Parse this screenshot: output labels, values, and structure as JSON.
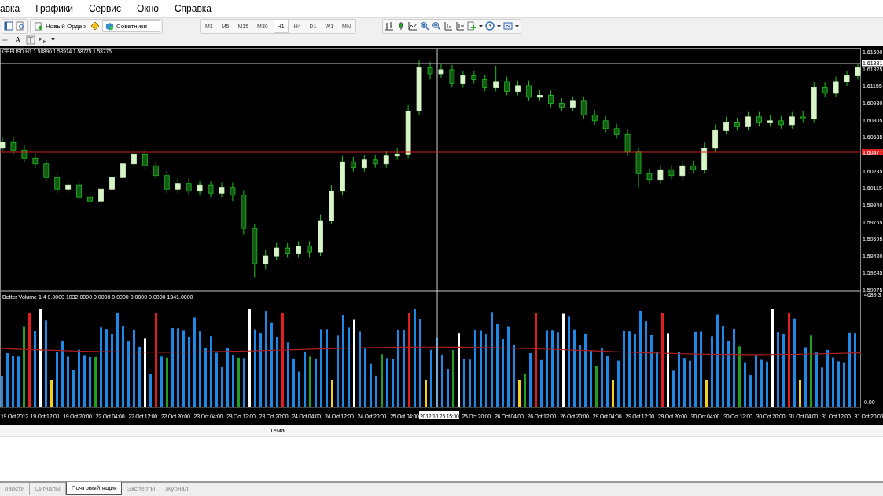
{
  "menu": [
    "авка",
    "Графики",
    "Сервис",
    "Окно",
    "Справка"
  ],
  "toolbar": {
    "new_order": "Новый Ордер",
    "experts": "Советники",
    "text_tool": "A",
    "timeframes": [
      {
        "label": "M1",
        "selected": false
      },
      {
        "label": "M5",
        "selected": false
      },
      {
        "label": "M15",
        "selected": false
      },
      {
        "label": "M30",
        "selected": false
      },
      {
        "label": "H1",
        "selected": true
      },
      {
        "label": "H4",
        "selected": false
      },
      {
        "label": "D1",
        "selected": false
      },
      {
        "label": "W1",
        "selected": false
      },
      {
        "label": "MN",
        "selected": false
      }
    ]
  },
  "chart": {
    "title": "GBPUSD.H1  1.58890 1.58914 1.58775 1.58775",
    "chart_data": {
      "type": "candlestick",
      "ylim": [
        1.5906,
        1.6154
      ],
      "yticks": [
        {
          "value": 1.615,
          "label": "1.61500"
        },
        {
          "value": 1.61325,
          "label": "1.61325"
        },
        {
          "value": 1.61155,
          "label": "1.61155"
        },
        {
          "value": 1.6098,
          "label": "1.60980"
        },
        {
          "value": 1.60805,
          "label": "1.60805"
        },
        {
          "value": 1.60635,
          "label": "1.60635"
        },
        {
          "value": 1.60285,
          "label": "1.60285"
        },
        {
          "value": 1.60115,
          "label": "1.60115"
        },
        {
          "value": 1.5994,
          "label": "1.59940"
        },
        {
          "value": 1.59765,
          "label": "1.59765"
        },
        {
          "value": 1.59595,
          "label": "1.59595"
        },
        {
          "value": 1.5942,
          "label": "1.59420"
        },
        {
          "value": 1.59245,
          "label": "1.59245"
        },
        {
          "value": 1.59075,
          "label": "1.59075"
        }
      ],
      "categories": [
        null,
        null,
        null,
        null,
        null,
        null,
        null,
        null,
        null,
        null,
        null,
        null,
        null,
        null,
        null,
        null,
        null,
        null,
        null,
        null,
        null,
        null,
        null,
        null,
        null,
        null,
        null,
        null,
        null,
        null,
        null,
        null,
        null,
        null,
        null,
        null,
        null,
        null,
        null,
        null,
        null,
        null,
        null,
        null,
        null,
        null,
        null,
        null,
        null,
        null,
        null,
        null,
        null,
        null,
        null,
        null,
        null,
        null,
        null,
        null,
        null,
        null,
        null,
        null,
        null,
        null,
        null,
        null,
        null,
        null,
        null,
        null,
        null,
        null,
        null,
        null,
        null,
        null,
        null
      ],
      "ohlc": [
        [
          1.6052,
          1.6063,
          1.6048,
          1.6058
        ],
        [
          1.6058,
          1.6063,
          1.6046,
          1.605
        ],
        [
          1.605,
          1.6055,
          1.6038,
          1.6042
        ],
        [
          1.6042,
          1.6047,
          1.6032,
          1.6036
        ],
        [
          1.6036,
          1.6041,
          1.6018,
          1.6022
        ],
        [
          1.6022,
          1.6027,
          1.6006,
          1.601
        ],
        [
          1.601,
          1.6019,
          1.6006,
          1.6014
        ],
        [
          1.6014,
          1.6019,
          1.5998,
          1.6002
        ],
        [
          1.6002,
          1.6007,
          1.599,
          1.5998
        ],
        [
          1.5998,
          1.6015,
          1.5994,
          1.601
        ],
        [
          1.601,
          1.6027,
          1.6006,
          1.6022
        ],
        [
          1.6022,
          1.6041,
          1.6018,
          1.6036
        ],
        [
          1.6036,
          1.6052,
          1.6032,
          1.6046
        ],
        [
          1.6046,
          1.6051,
          1.603,
          1.6034
        ],
        [
          1.6034,
          1.6039,
          1.602,
          1.6024
        ],
        [
          1.6024,
          1.6029,
          1.6006,
          1.601
        ],
        [
          1.601,
          1.6021,
          1.6006,
          1.6016
        ],
        [
          1.6016,
          1.6021,
          1.6004,
          1.6008
        ],
        [
          1.6008,
          1.6019,
          1.6004,
          1.6014
        ],
        [
          1.6014,
          1.6019,
          1.6002,
          1.6006
        ],
        [
          1.6006,
          1.6017,
          1.6002,
          1.6012
        ],
        [
          1.6012,
          1.6017,
          1.5998,
          1.6004
        ],
        [
          1.6004,
          1.6009,
          1.5964,
          1.597
        ],
        [
          1.597,
          1.5975,
          1.592,
          1.5934
        ],
        [
          1.5934,
          1.5948,
          1.5928,
          1.5942
        ],
        [
          1.5942,
          1.5956,
          1.5938,
          1.595
        ],
        [
          1.595,
          1.5955,
          1.594,
          1.5944
        ],
        [
          1.5944,
          1.5957,
          1.594,
          1.5952
        ],
        [
          1.5952,
          1.5957,
          1.594,
          1.5946
        ],
        [
          1.5946,
          1.5984,
          1.5942,
          1.5978
        ],
        [
          1.5978,
          1.6014,
          1.5974,
          1.6008
        ],
        [
          1.6008,
          1.6044,
          1.6004,
          1.6038
        ],
        [
          1.6038,
          1.6043,
          1.6028,
          1.6032
        ],
        [
          1.6032,
          1.6045,
          1.6028,
          1.604
        ],
        [
          1.604,
          1.6045,
          1.6032,
          1.6036
        ],
        [
          1.6036,
          1.6049,
          1.6032,
          1.6044
        ],
        [
          1.6044,
          1.6052,
          1.604,
          1.6046
        ],
        [
          1.6046,
          1.6096,
          1.6042,
          1.609
        ],
        [
          1.609,
          1.6142,
          1.6086,
          1.6134
        ],
        [
          1.6134,
          1.614,
          1.6122,
          1.6128
        ],
        [
          1.6128,
          1.6138,
          1.6124,
          1.6132
        ],
        [
          1.6132,
          1.6137,
          1.6114,
          1.6118
        ],
        [
          1.6118,
          1.6131,
          1.6114,
          1.6126
        ],
        [
          1.6126,
          1.6131,
          1.6118,
          1.6122
        ],
        [
          1.6122,
          1.6127,
          1.611,
          1.6114
        ],
        [
          1.6114,
          1.6136,
          1.611,
          1.612
        ],
        [
          1.612,
          1.6125,
          1.6106,
          1.611
        ],
        [
          1.611,
          1.6121,
          1.6106,
          1.6116
        ],
        [
          1.6116,
          1.6121,
          1.61,
          1.6104
        ],
        [
          1.6104,
          1.6111,
          1.61,
          1.6106
        ],
        [
          1.6106,
          1.6111,
          1.6094,
          1.6098
        ],
        [
          1.6098,
          1.6103,
          1.609,
          1.6094
        ],
        [
          1.6094,
          1.6105,
          1.609,
          1.61
        ],
        [
          1.61,
          1.6105,
          1.6082,
          1.6086
        ],
        [
          1.6086,
          1.6091,
          1.6076,
          1.608
        ],
        [
          1.608,
          1.6085,
          1.6068,
          1.6072
        ],
        [
          1.6072,
          1.6077,
          1.6062,
          1.6066
        ],
        [
          1.6066,
          1.6071,
          1.6044,
          1.6048
        ],
        [
          1.6048,
          1.6053,
          1.6012,
          1.6026
        ],
        [
          1.6026,
          1.6031,
          1.6016,
          1.602
        ],
        [
          1.602,
          1.6035,
          1.6016,
          1.603
        ],
        [
          1.603,
          1.6035,
          1.602,
          1.6024
        ],
        [
          1.6024,
          1.6039,
          1.602,
          1.6034
        ],
        [
          1.6034,
          1.6039,
          1.6026,
          1.603
        ],
        [
          1.603,
          1.6058,
          1.6026,
          1.6052
        ],
        [
          1.6052,
          1.6076,
          1.6048,
          1.607
        ],
        [
          1.607,
          1.6084,
          1.6066,
          1.6078
        ],
        [
          1.6078,
          1.6083,
          1.607,
          1.6074
        ],
        [
          1.6074,
          1.6089,
          1.607,
          1.6084
        ],
        [
          1.6084,
          1.6089,
          1.6074,
          1.6078
        ],
        [
          1.6078,
          1.6086,
          1.6074,
          1.608
        ],
        [
          1.608,
          1.6085,
          1.6072,
          1.6076
        ],
        [
          1.6076,
          1.6089,
          1.6072,
          1.6084
        ],
        [
          1.6084,
          1.609,
          1.6078,
          1.6082
        ],
        [
          1.6082,
          1.612,
          1.6078,
          1.6114
        ],
        [
          1.6114,
          1.6119,
          1.6104,
          1.6108
        ],
        [
          1.6108,
          1.6125,
          1.6104,
          1.612
        ],
        [
          1.612,
          1.6131,
          1.6116,
          1.6126
        ],
        [
          1.6126,
          1.6138,
          1.6122,
          1.6134
        ]
      ]
    },
    "crosshair_price": "1.61381",
    "bid_price": "1.60477",
    "indicator_title": "Better Volume 1.4 0.0000 1032.0000 0.0000 0.0000 0.0000 0.0000 1341.0000",
    "volume_labels": [
      "4689.3",
      "0.00"
    ],
    "time_labels": [
      "19 Oct 2012",
      "19 Oct 12:00",
      "19 Oct 20:00",
      "22 Oct 04:00",
      "22 Oct 12:00",
      "22 Oct 20:00",
      "23 Oct 04:00",
      "23 Oct 12:00",
      "23 Oct 20:00",
      "24 Oct 04:00",
      "24 Oct 12:00",
      "24 Oct 20:00",
      "25 Oct 04:00",
      "25 Oct 20:00",
      "26 Oct 04:00",
      "26 Oct 12:00",
      "26 Oct 20:00",
      "29 Oct 04:00",
      "29 Oct 12:00",
      "29 Oct 20:00",
      "30 Oct 04:00",
      "30 Oct 12:00",
      "30 Oct 20:00",
      "31 Oct 04:00",
      "31 Oct 12:00",
      "31 Oct 20:00"
    ],
    "crosshair_time": "2012.10.25 15:00"
  },
  "terminal": {
    "column": "Тема",
    "tabs": [
      {
        "label": "овости",
        "selected": false
      },
      {
        "label": "Сигналы",
        "selected": false
      },
      {
        "label": "Почтовый ящик",
        "selected": true
      },
      {
        "label": "Эксперты",
        "selected": false
      },
      {
        "label": "Журнал",
        "selected": false
      }
    ]
  }
}
